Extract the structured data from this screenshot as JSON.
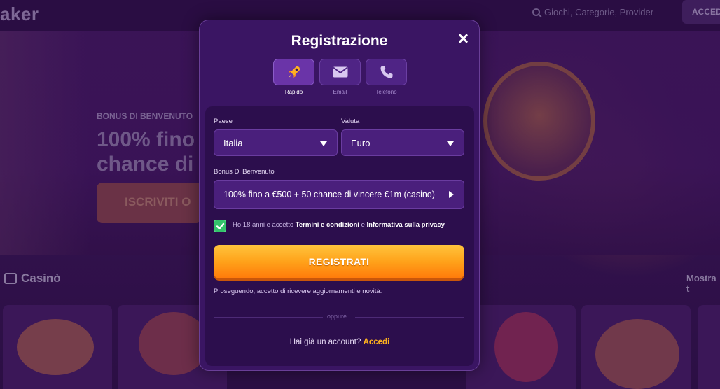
{
  "background": {
    "logo_text": "aker",
    "search_placeholder": "Giochi, Categorie, Provider",
    "access_button": "ACCEDI",
    "bonus_label": "BONUS DI BENVENUTO",
    "bonus_title_line1": "100% fino",
    "bonus_title_line2": "chance di",
    "cta_label": "ISCRIVITI O",
    "section_title": "Casinò",
    "show_more": "Mostra t"
  },
  "modal": {
    "title": "Registrazione",
    "tabs": [
      {
        "label": "Rapido",
        "icon": "rocket-icon",
        "active": true
      },
      {
        "label": "Email",
        "icon": "envelope-icon",
        "active": false
      },
      {
        "label": "Telefono",
        "icon": "phone-icon",
        "active": false
      }
    ],
    "country": {
      "label": "Paese",
      "value": "Italia"
    },
    "currency": {
      "label": "Valuta",
      "value": "Euro"
    },
    "bonus": {
      "label": "Bonus Di Benvenuto",
      "value": "100% fino a €500 + 50 chance di vincere €1m (casino)"
    },
    "consent": {
      "checked": true,
      "prefix": "Ho 18 anni e accetto ",
      "terms": "Termini e condizioni",
      "and": " e ",
      "privacy": "Informativa sulla privacy"
    },
    "submit_label": "REGISTRATI",
    "notice": "Proseguendo, accetto di ricevere aggiornamenti e novità.",
    "or_text": "oppure",
    "login_prompt": "Hai già un account?",
    "login_link": "Accedi"
  },
  "colors": {
    "accent_orange": "#ffa21a",
    "link_yellow": "#ffb21e",
    "check_green": "#33c36b",
    "modal_bg": "#3a1563"
  }
}
